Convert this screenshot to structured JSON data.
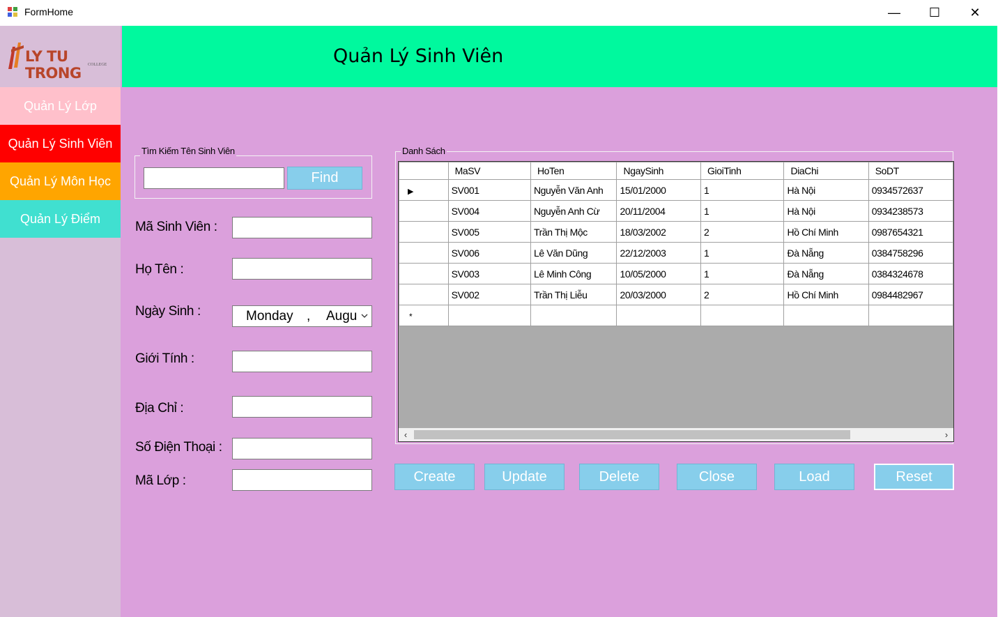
{
  "window": {
    "title": "FormHome",
    "minimize_glyph": "—",
    "maximize_glyph": "☐",
    "close_glyph": "✕"
  },
  "logo": {
    "text": "LY TU TRONG",
    "sub": "COLLEGE"
  },
  "nav": [
    {
      "label": "Quản Lý Lớp",
      "bg": "#ffc0cb",
      "color": "#ffffff"
    },
    {
      "label": "Quản Lý Sinh Viên",
      "bg": "#ff0000",
      "color": "#ffffff"
    },
    {
      "label": "Quản Lý Môn Học",
      "bg": "#ffa500",
      "color": "#ffffff"
    },
    {
      "label": "Quản Lý Điểm",
      "bg": "#40e0d0",
      "color": "#ffffff"
    }
  ],
  "header": {
    "title": "Quản Lý Sinh Viên",
    "bg": "#00f99e"
  },
  "search": {
    "group_label": "Tìm Kiếm Tên Sinh Viên",
    "value": "",
    "button": "Find"
  },
  "form": {
    "ma_sv_label": "Mã Sinh Viên :",
    "ho_ten_label": "Họ Tên :",
    "ngay_sinh_label": "Ngày Sinh :",
    "ngay_sinh_value_day": "Monday",
    "ngay_sinh_value_month": "Augu",
    "gioi_tinh_label": "Giới Tính :",
    "dia_chi_label": "Địa Chỉ :",
    "so_dien_thoai_label": "Số Điện Thoại :",
    "ma_lop_label": "Mã Lớp :"
  },
  "list": {
    "group_label": "Danh Sách",
    "columns": [
      "MaSV",
      "HoTen",
      "NgaySinh",
      "GioiTinh",
      "DiaChi",
      "SoDT"
    ],
    "rows": [
      [
        "SV001",
        "Nguyễn Văn Anh",
        "15/01/2000",
        "1",
        "Hà Nội",
        "0934572637"
      ],
      [
        "SV004",
        "Nguyễn Anh Cừ",
        "20/11/2004",
        "1",
        "Hà Nội",
        "0934238573"
      ],
      [
        "SV005",
        "Trần Thị Mộc",
        "18/03/2002",
        "2",
        "Hồ Chí Minh",
        "0987654321"
      ],
      [
        "SV006",
        "Lê Văn Dũng",
        "22/12/2003",
        "1",
        "Đà Nẵng",
        "0384758296"
      ],
      [
        "SV003",
        "Lê Minh Công",
        "10/05/2000",
        "1",
        "Đà Nẵng",
        "0384324678"
      ],
      [
        "SV002",
        "Trần Thị Liễu",
        "20/03/2000",
        "2",
        "Hồ Chí Minh",
        "0984482967"
      ]
    ],
    "current_row_glyph": "▶",
    "new_row_glyph": "*"
  },
  "buttons": {
    "create": "Create",
    "update": "Update",
    "delete": "Delete",
    "close": "Close",
    "load": "Load",
    "reset": "Reset"
  },
  "colors": {
    "client_bg": "#dba0dc",
    "button_bg": "#87ceeb",
    "sidebar_bg": "#d8bed8"
  }
}
